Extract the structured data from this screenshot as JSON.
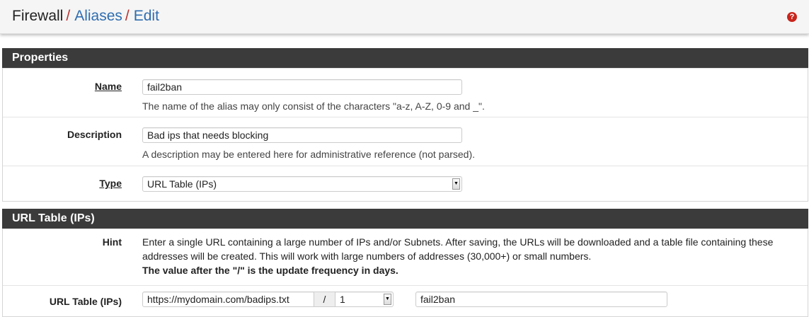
{
  "breadcrumb": {
    "section": "Firewall",
    "aliases": "Aliases",
    "edit": "Edit",
    "separator": "/",
    "help_icon_glyph": "?"
  },
  "properties": {
    "heading": "Properties",
    "name_label": "Name",
    "name_value": "fail2ban",
    "name_help": "The name of the alias may only consist of the characters \"a-z, A-Z, 0-9 and _\".",
    "description_label": "Description",
    "description_value": "Bad ips that needs blocking",
    "description_help": "A description may be entered here for administrative reference (not parsed).",
    "type_label": "Type",
    "type_value": "URL Table (IPs)"
  },
  "url_table": {
    "heading": "URL Table (IPs)",
    "hint_label": "Hint",
    "hint_line1": "Enter a single URL containing a large number of IPs and/or Subnets. After saving, the URLs will be downloaded and a table file containing these",
    "hint_line2": "addresses will be created. This will work with large numbers of addresses (30,000+) or small numbers.",
    "hint_bold": "The value after the \"/\" is the update frequency in days.",
    "row_label": "URL Table (IPs)",
    "url_value": "https://mydomain.com/badips.txt",
    "slash": "/",
    "frequency_value": "1",
    "description_value": "fail2ban"
  },
  "colors": {
    "header_bg": "#3b3b3b",
    "link": "#2f6db0",
    "separator": "#b8312f",
    "help_icon": "#c8251c"
  }
}
